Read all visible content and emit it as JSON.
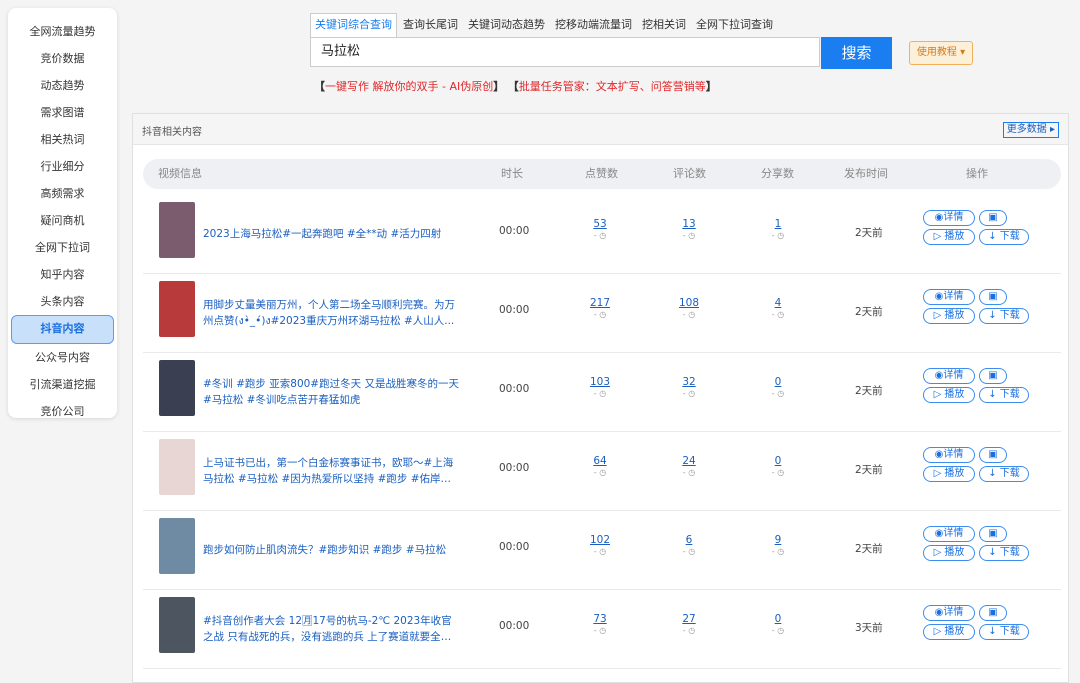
{
  "sidebar": {
    "items": [
      {
        "label": "全网流量趋势"
      },
      {
        "label": "竞价数据"
      },
      {
        "label": "动态趋势"
      },
      {
        "label": "需求图谱"
      },
      {
        "label": "相关热词"
      },
      {
        "label": "行业细分"
      },
      {
        "label": "高频需求"
      },
      {
        "label": "疑问商机"
      },
      {
        "label": "全网下拉词"
      },
      {
        "label": "知乎内容"
      },
      {
        "label": "头条内容"
      },
      {
        "label": "抖音内容",
        "active": true
      },
      {
        "label": "公众号内容"
      },
      {
        "label": "引流渠道挖掘"
      },
      {
        "label": "竞价公司"
      }
    ]
  },
  "tabs": [
    {
      "label": "关键词综合查询",
      "active": true
    },
    {
      "label": "查询长尾词"
    },
    {
      "label": "关键词动态趋势"
    },
    {
      "label": "挖移动端流量词"
    },
    {
      "label": "挖相关词"
    },
    {
      "label": "全网下拉词查询"
    }
  ],
  "search": {
    "value": "马拉松",
    "button": "搜索",
    "help": "使用教程 ▾"
  },
  "promo": {
    "left_bracket": "【",
    "link1": "一键写作 解放你的双手 - AI伪原创",
    "right_bracket": "】",
    "link2_open": "【",
    "link2": "批量任务管家：文本扩写、问答营销等",
    "link2_close": "】"
  },
  "panel": {
    "title": "抖音相关内容",
    "more": "更多数据 ▸",
    "headers": {
      "video": "视频信息",
      "duration": "时长",
      "likes": "点赞数",
      "comments": "评论数",
      "shares": "分享数",
      "date": "发布时间",
      "ops": "操作"
    },
    "ops": {
      "detail": "◉详情",
      "qr": "▣",
      "play": "▷ 播放",
      "download": "↓ 下载"
    },
    "stat_sub": "- ◷",
    "rows": [
      {
        "title": "2023上海马拉松#一起奔跑吧 #全**动 #活力四射",
        "duration": "00:00",
        "likes": "53",
        "comments": "13",
        "shares": "1",
        "date": "2天前",
        "thumb_color": "#7a5c6e"
      },
      {
        "title": "用脚步丈量美丽万州，个人第二场全马顺利完赛。为万州点赞(ง•̀_•́)ง#2023重庆万州环湖马拉松 #人山人...",
        "duration": "00:00",
        "likes": "217",
        "comments": "108",
        "shares": "4",
        "date": "2天前",
        "thumb_color": "#b83a3a"
      },
      {
        "title": "#冬训 #跑步 亚索800#跑过冬天 又是战胜寒冬的一天#马拉松 #冬训吃点苦开春猛如虎",
        "duration": "00:00",
        "likes": "103",
        "comments": "32",
        "shares": "0",
        "date": "2天前",
        "thumb_color": "#3a3f52"
      },
      {
        "title": "上马证书已出，第一个白金标赛事证书，欧耶～#上海马拉松 #马拉松 #因为热爱所以坚持 #跑步 #佑岸体创",
        "duration": "00:00",
        "likes": "64",
        "comments": "24",
        "shares": "0",
        "date": "2天前",
        "thumb_color": "#e8d6d4"
      },
      {
        "title": "跑步如何防止肌肉流失？#跑步知识 #跑步 #马拉松",
        "duration": "00:00",
        "likes": "102",
        "comments": "6",
        "shares": "9",
        "date": "2天前",
        "thumb_color": "#6f8aa3"
      },
      {
        "title": "#抖音创作者大会 12🈷17号的杭马-2℃ 2023年收官之战 只有战死的兵，没有逃跑的兵 上了赛道就要全力以...",
        "duration": "00:00",
        "likes": "73",
        "comments": "27",
        "shares": "0",
        "date": "3天前",
        "thumb_color": "#4c5560"
      }
    ]
  }
}
